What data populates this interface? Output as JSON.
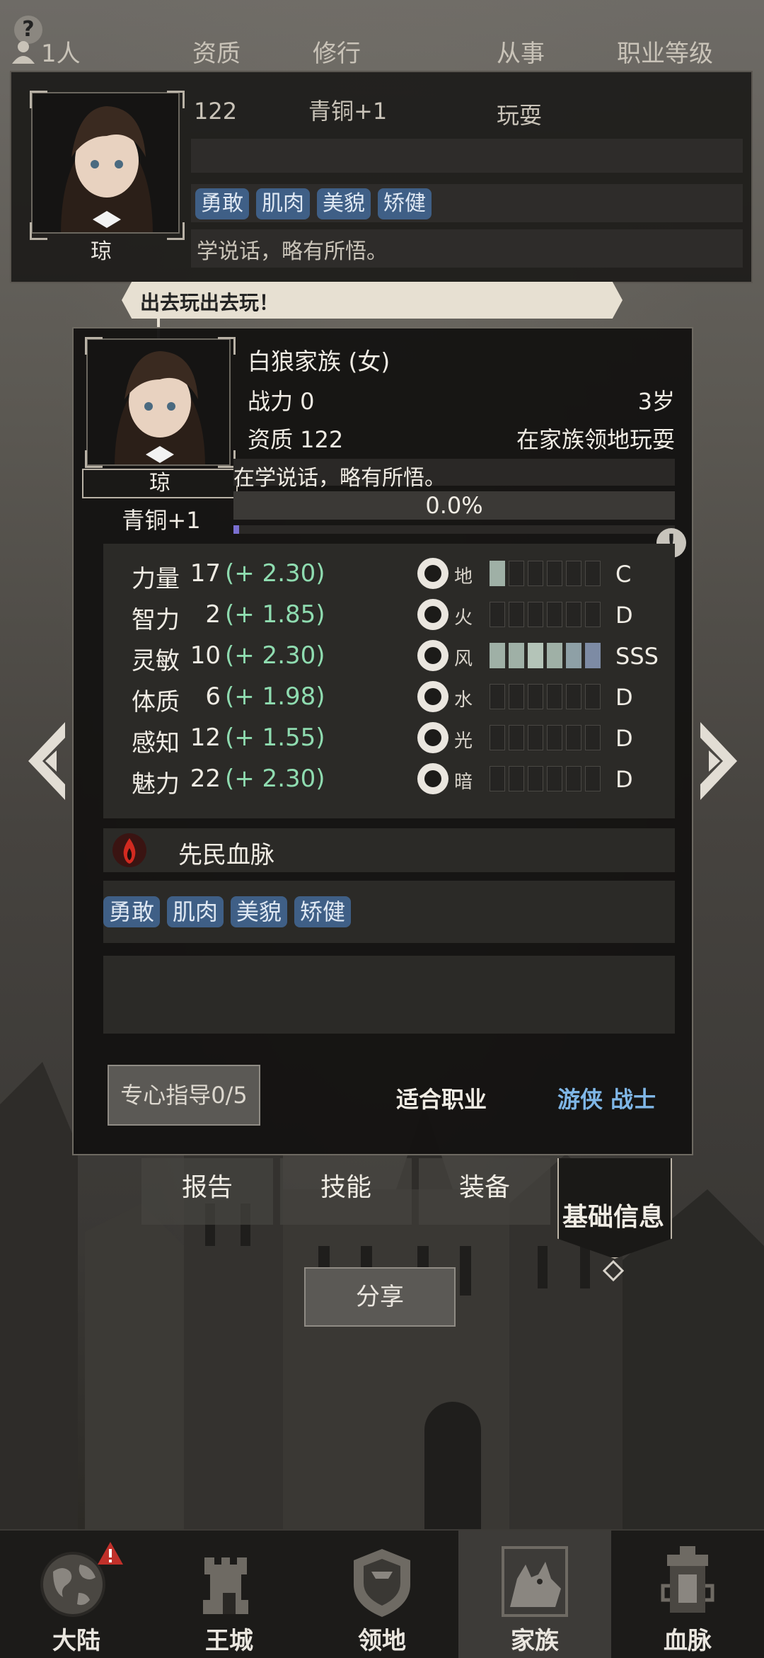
{
  "header": {
    "count": "1人",
    "col_aptitude": "资质",
    "col_cultivation": "修行",
    "col_activity": "从事",
    "col_job_level": "职业等级"
  },
  "top_card": {
    "aptitude": "122",
    "cultivation": "青铜+1",
    "activity": "玩耍",
    "name": "琼",
    "tags": [
      "勇敢",
      "肌肉",
      "美貌",
      "矫健"
    ],
    "desc": "学说话，略有所悟。"
  },
  "bubble": "出去玩出去玩！",
  "character": {
    "family": "白狼家族 (女)",
    "power": "战力 0",
    "age": "3岁",
    "aptitude": "资质 122",
    "status": "在家族领地玩耍",
    "name": "琼",
    "rank": "青铜+1",
    "learning": "在学说话，略有所悟。",
    "progress": "0.0%",
    "progress_fraction": 0.0
  },
  "stats": [
    {
      "label": "力量",
      "value": "17",
      "bonus": "(+ 2.30)"
    },
    {
      "label": "智力",
      "value": "2",
      "bonus": "(+ 1.85)"
    },
    {
      "label": "灵敏",
      "value": "10",
      "bonus": "(+ 2.30)"
    },
    {
      "label": "体质",
      "value": "6",
      "bonus": "(+ 1.98)"
    },
    {
      "label": "感知",
      "value": "12",
      "bonus": "(+ 1.55)"
    },
    {
      "label": "魅力",
      "value": "22",
      "bonus": "(+ 2.30)"
    }
  ],
  "elements": [
    {
      "name": "地",
      "icon": "earth-icon",
      "grade": "C",
      "filled": 1
    },
    {
      "name": "火",
      "icon": "fire-icon",
      "grade": "D",
      "filled": 0
    },
    {
      "name": "风",
      "icon": "wind-icon",
      "grade": "SSS",
      "filled": 6
    },
    {
      "name": "水",
      "icon": "water-icon",
      "grade": "D",
      "filled": 0
    },
    {
      "name": "光",
      "icon": "light-icon",
      "grade": "D",
      "filled": 0
    },
    {
      "name": "暗",
      "icon": "dark-icon",
      "grade": "D",
      "filled": 0
    }
  ],
  "bloodline": "先民血脉",
  "traits": [
    "勇敢",
    "肌肉",
    "美貌",
    "矫健"
  ],
  "mentor_button": "专心指导0/5",
  "suitable_job_label": "适合职业",
  "suitable_jobs": "游侠 战士",
  "tabs": {
    "report": "报告",
    "skills": "技能",
    "equipment": "装备",
    "basic_info": "基础信息"
  },
  "share_button": "分享",
  "nav": [
    "大陆",
    "王城",
    "领地",
    "家族",
    "血脉"
  ],
  "colors": {
    "bonus_green": "#8fdcb0",
    "tag_blue": "#3f5f86",
    "job_blue": "#7fb6e6",
    "alert_red": "#c0302a"
  }
}
